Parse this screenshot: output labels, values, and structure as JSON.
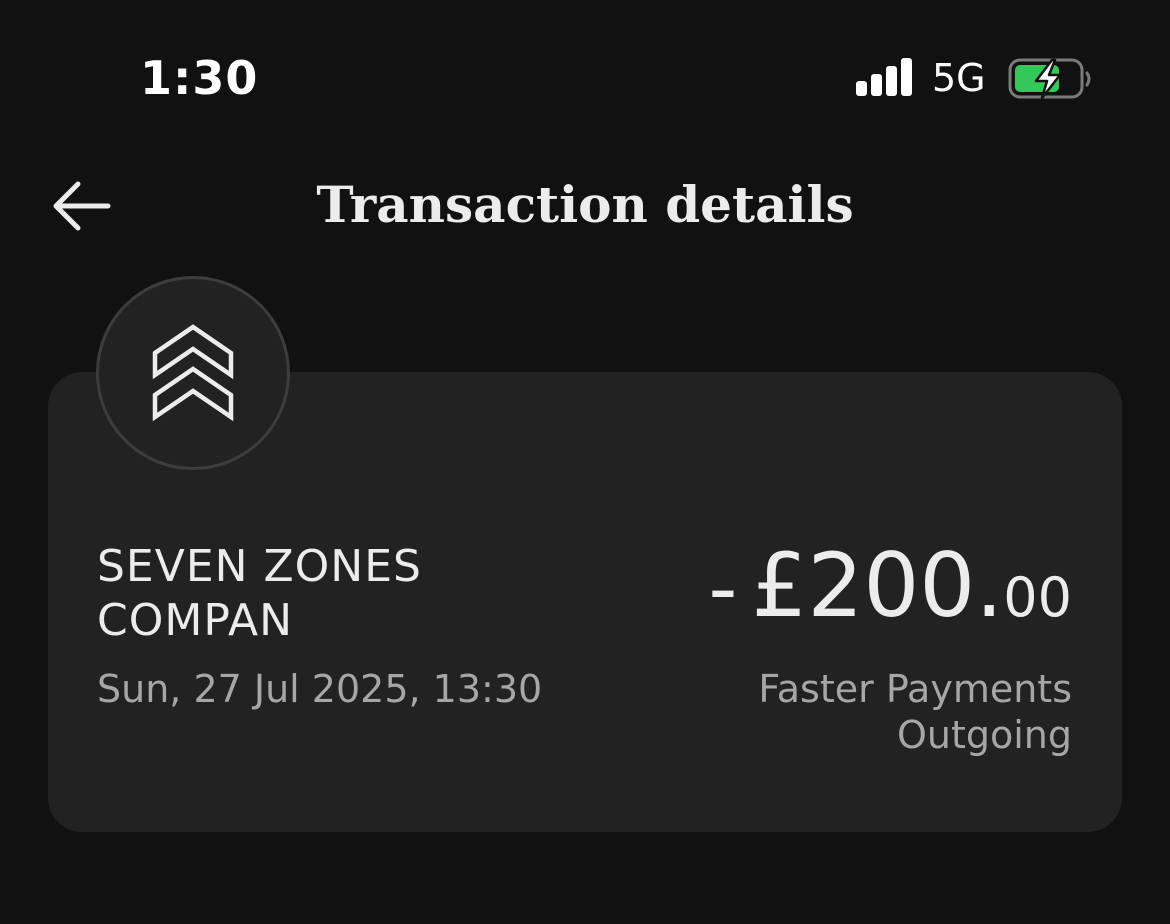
{
  "status_bar": {
    "time": "1:30",
    "network": "5G",
    "battery_color": "#34c759",
    "charging": true
  },
  "header": {
    "title": "Transaction details",
    "back_icon": "arrow-left-icon"
  },
  "transaction": {
    "merchant_icon": "double-chevron-up-icon",
    "merchant_name": "SEVEN ZONES COMPAN",
    "date": "Sun, 27 Jul 2025, 13:30",
    "amount_sign": "-",
    "amount_major": "£200.",
    "amount_minor": "00",
    "payment_type": "Faster Payments Outgoing"
  },
  "colors": {
    "background": "#111111",
    "card": "#222222",
    "primary_text": "#ececec",
    "secondary_text": "#a6a6a6"
  }
}
